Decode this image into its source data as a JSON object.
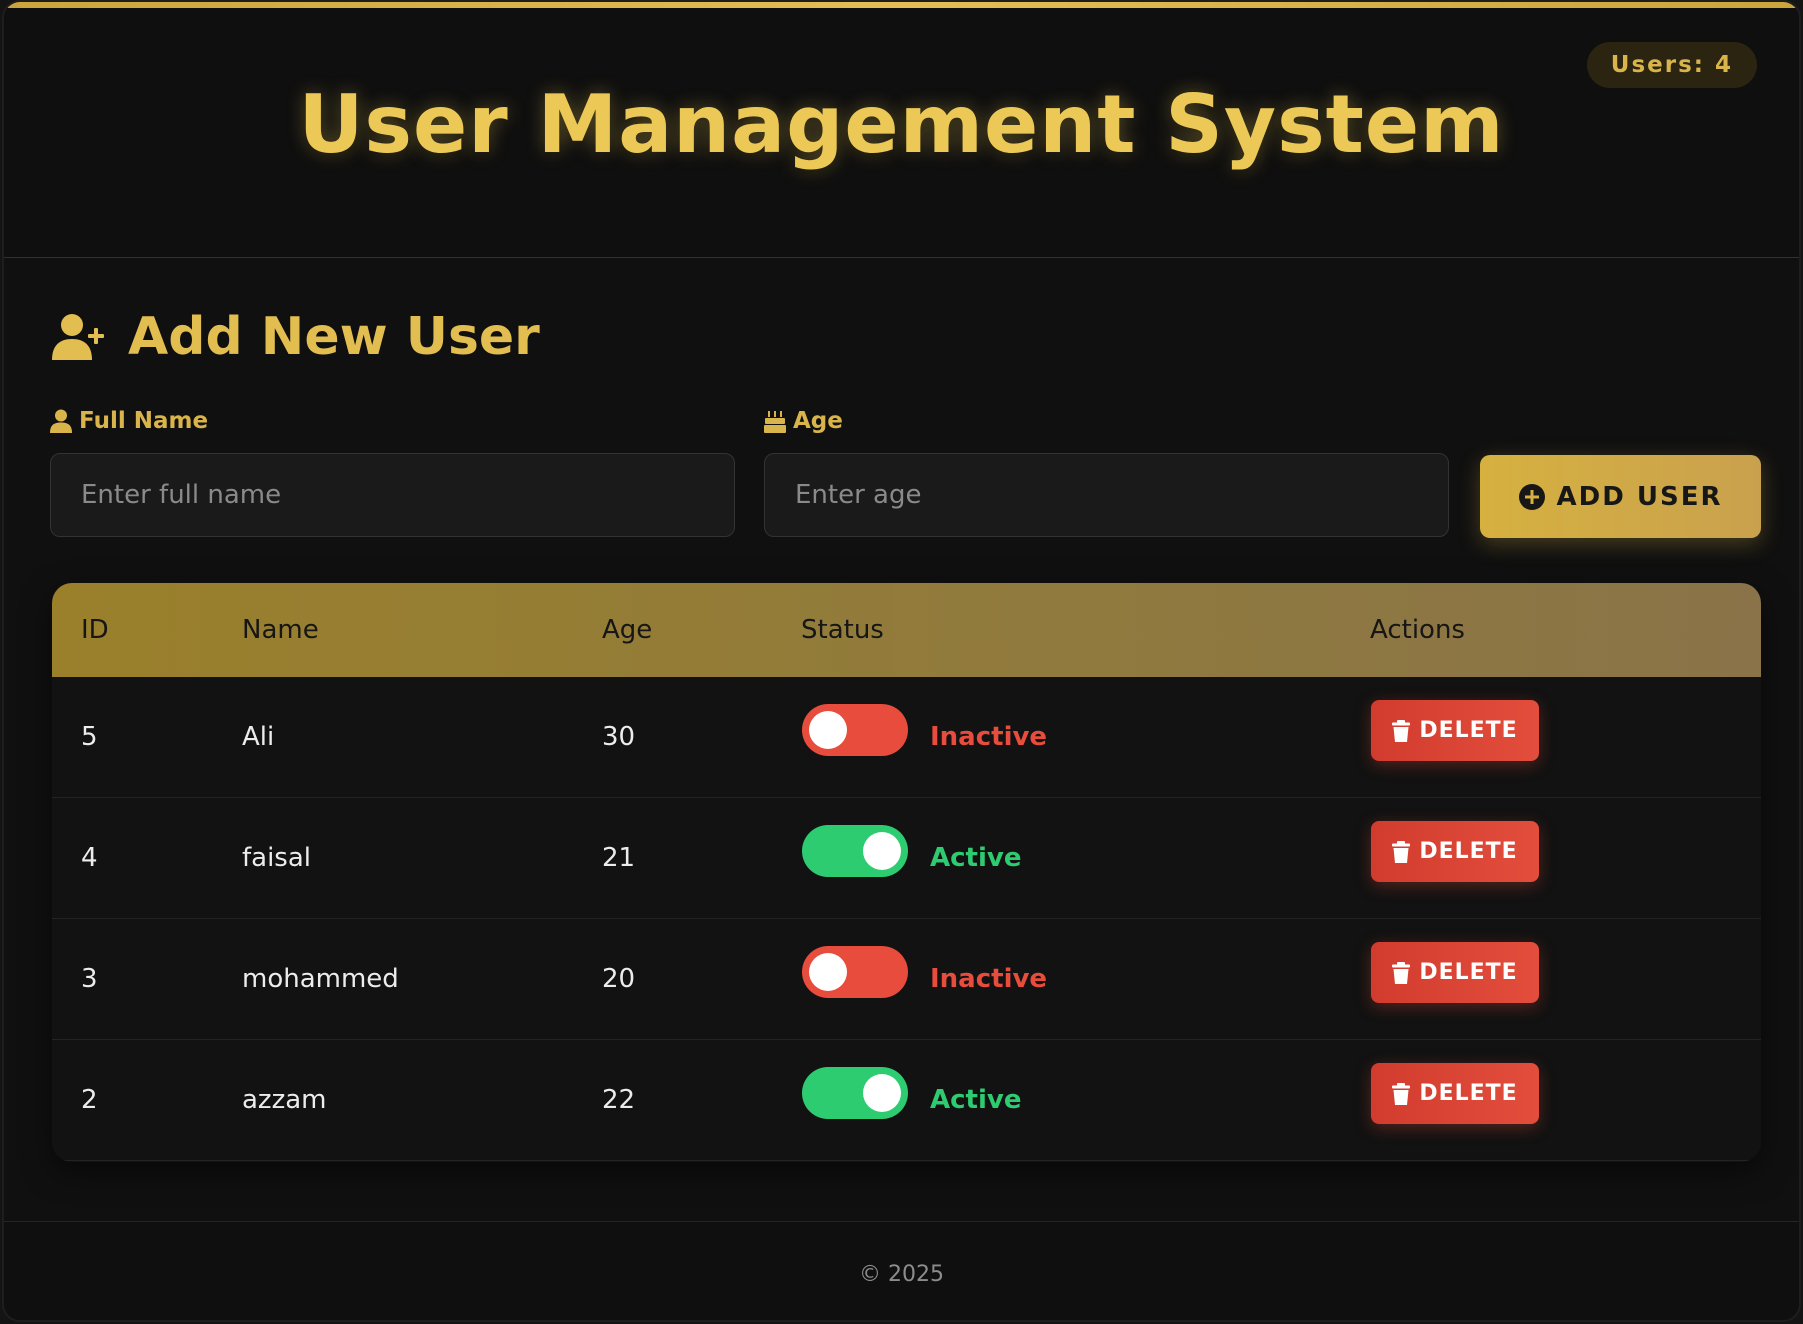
{
  "header": {
    "title": "User Management System",
    "users_badge": "Users: 4"
  },
  "form": {
    "section_title": "Add New User",
    "section_icon": "user-plus-icon",
    "name_label": "Full Name",
    "name_icon": "user-icon",
    "name_placeholder": "Enter full name",
    "name_value": "",
    "age_label": "Age",
    "age_icon": "birthday-cake-icon",
    "age_placeholder": "Enter age",
    "age_value": "",
    "add_button": "ADD USER",
    "add_icon": "plus-circle-icon"
  },
  "table": {
    "headers": [
      "ID",
      "Name",
      "Age",
      "Status",
      "Actions"
    ],
    "rows": [
      {
        "id": "5",
        "name": "Ali",
        "age": "30",
        "active": false,
        "status": "Inactive",
        "action": "DELETE"
      },
      {
        "id": "4",
        "name": "faisal",
        "age": "21",
        "active": true,
        "status": "Active",
        "action": "DELETE"
      },
      {
        "id": "3",
        "name": "mohammed",
        "age": "20",
        "active": false,
        "status": "Inactive",
        "action": "DELETE"
      },
      {
        "id": "2",
        "name": "azzam",
        "age": "22",
        "active": true,
        "status": "Active",
        "action": "DELETE"
      }
    ]
  },
  "footer": {
    "copyright": "© 2025"
  },
  "colors": {
    "accent_gold": "#ecc957",
    "active_green": "#2ecc71",
    "inactive_red": "#e74c3c",
    "delete_red": "#d23c2e"
  }
}
